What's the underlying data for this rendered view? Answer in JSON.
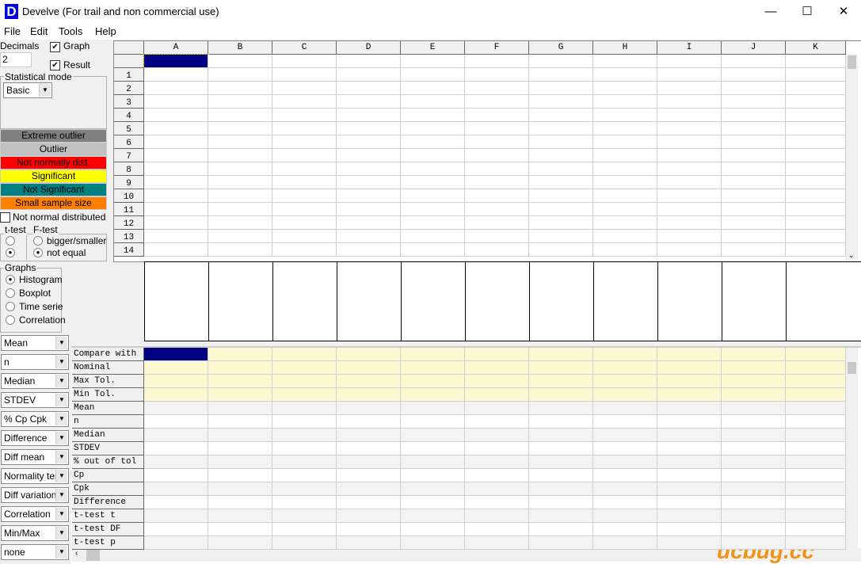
{
  "window": {
    "title": "Develve (For trail and non commercial use)",
    "logo": "D",
    "minimize": "—",
    "maximize": "☐",
    "close": "✕"
  },
  "menu": [
    "File",
    "Edit",
    "Tools",
    "Help"
  ],
  "options": {
    "decimals_label": "Decimals",
    "decimals_value": "2",
    "graph_label": "Graph",
    "graph_checked": true,
    "result_label": "Result",
    "result_checked": true,
    "stat_mode_label": "Statistical mode",
    "stat_mode_value": "Basic"
  },
  "legend": [
    {
      "label": "Extreme outlier",
      "color": "#808080",
      "text": "#000"
    },
    {
      "label": "Outlier",
      "color": "#c0c0c0",
      "text": "#000"
    },
    {
      "label": "Not normally dist.",
      "color": "#ff0000",
      "text": "#000"
    },
    {
      "label": "Significant",
      "color": "#ffff00",
      "text": "#000"
    },
    {
      "label": "Not Significant",
      "color": "#008080",
      "text": "#000"
    },
    {
      "label": "Small sample size",
      "color": "#ff8000",
      "text": "#000"
    }
  ],
  "not_normal_label": "Not normal distributed",
  "ttest": {
    "label": "t-test"
  },
  "ftest": {
    "label": "F-test",
    "options": [
      "bigger/smaller",
      "not equal"
    ],
    "selected": 1
  },
  "graphs": {
    "label": "Graphs",
    "options": [
      "Histogram",
      "Boxplot",
      "Time serie",
      "Correlation"
    ],
    "selected": 0
  },
  "selectors": [
    "Mean",
    "n",
    "Median",
    "STDEV",
    "% Cp Cpk",
    "Difference",
    "Diff mean",
    "Normality test",
    "Diff variation",
    "Correlation",
    "Min/Max",
    "none"
  ],
  "columns": [
    "A",
    "B",
    "C",
    "D",
    "E",
    "F",
    "G",
    "H",
    "I",
    "J",
    "K"
  ],
  "rows": [
    "1",
    "2",
    "3",
    "4",
    "5",
    "6",
    "7",
    "8",
    "9",
    "10",
    "11",
    "12",
    "13",
    "14"
  ],
  "results_rows": [
    "Compare with",
    "Nominal",
    "Max Tol.",
    "Min Tol.",
    "Mean",
    "n",
    "Median",
    "STDEV",
    "% out of tol",
    "Cp",
    "Cpk",
    "Difference",
    "t-test t",
    "t-test DF",
    "t-test p"
  ],
  "colors": {
    "selection": "#000080",
    "tolerance_row": "#fdf7d2",
    "alt_row": "#f3f3f3"
  },
  "watermark": "软件下载站 ucbug.cc"
}
